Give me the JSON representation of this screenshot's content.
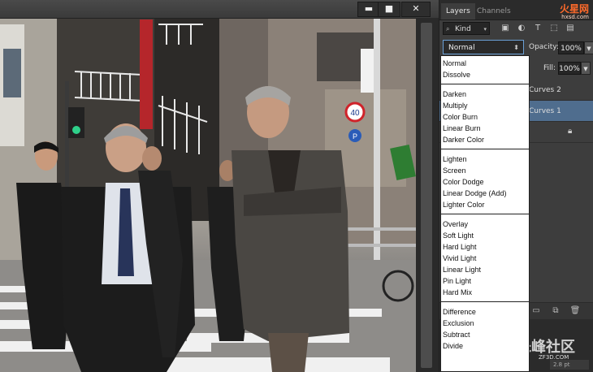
{
  "window": {
    "minimize_icon": "minimize-icon",
    "maximize_icon": "maximize-icon",
    "close_icon": "close-icon",
    "minimize_glyph": "▬",
    "maximize_glyph": "■",
    "close_glyph": "✕"
  },
  "canvas": {
    "signs": {
      "speed_limit": "40",
      "parking": "P"
    }
  },
  "panel": {
    "tabs": [
      "Layers",
      "Channels"
    ],
    "logo": {
      "main": "火星网",
      "sub": "hxsd.com"
    },
    "filter": {
      "kind_label": "Kind",
      "icons": [
        "image-filter-icon",
        "adjustment-filter-icon",
        "type-filter-icon",
        "shape-filter-icon",
        "smart-object-filter-icon"
      ]
    },
    "blend_mode": {
      "value": "Normal"
    },
    "opacity": {
      "label": "Opacity:",
      "value": "100%"
    },
    "fill": {
      "label": "Fill:",
      "value": "100%"
    },
    "layers": [
      {
        "name": "Curves 2"
      },
      {
        "name": "Curves 1"
      },
      {
        "name": ""
      }
    ],
    "lower": {
      "size_value": "2.8 pt",
      "watermark": "朱峰社区",
      "watermark_sub": "ZF3D.COM"
    }
  },
  "blend_menu": {
    "groups": [
      [
        "Normal",
        "Dissolve"
      ],
      [
        "Darken",
        "Multiply",
        "Color Burn",
        "Linear Burn",
        "Darker Color"
      ],
      [
        "Lighten",
        "Screen",
        "Color Dodge",
        "Linear Dodge (Add)",
        "Lighter Color"
      ],
      [
        "Overlay",
        "Soft Light",
        "Hard Light",
        "Vivid Light",
        "Linear Light",
        "Pin Light",
        "Hard Mix"
      ],
      [
        "Difference",
        "Exclusion",
        "Subtract",
        "Divide"
      ]
    ]
  },
  "colors": {
    "panel_bg": "#3d3d3d",
    "selected_layer": "#4f6d8e",
    "focus_ring": "#6aa0d6",
    "logo_orange": "#ff6a2a"
  }
}
